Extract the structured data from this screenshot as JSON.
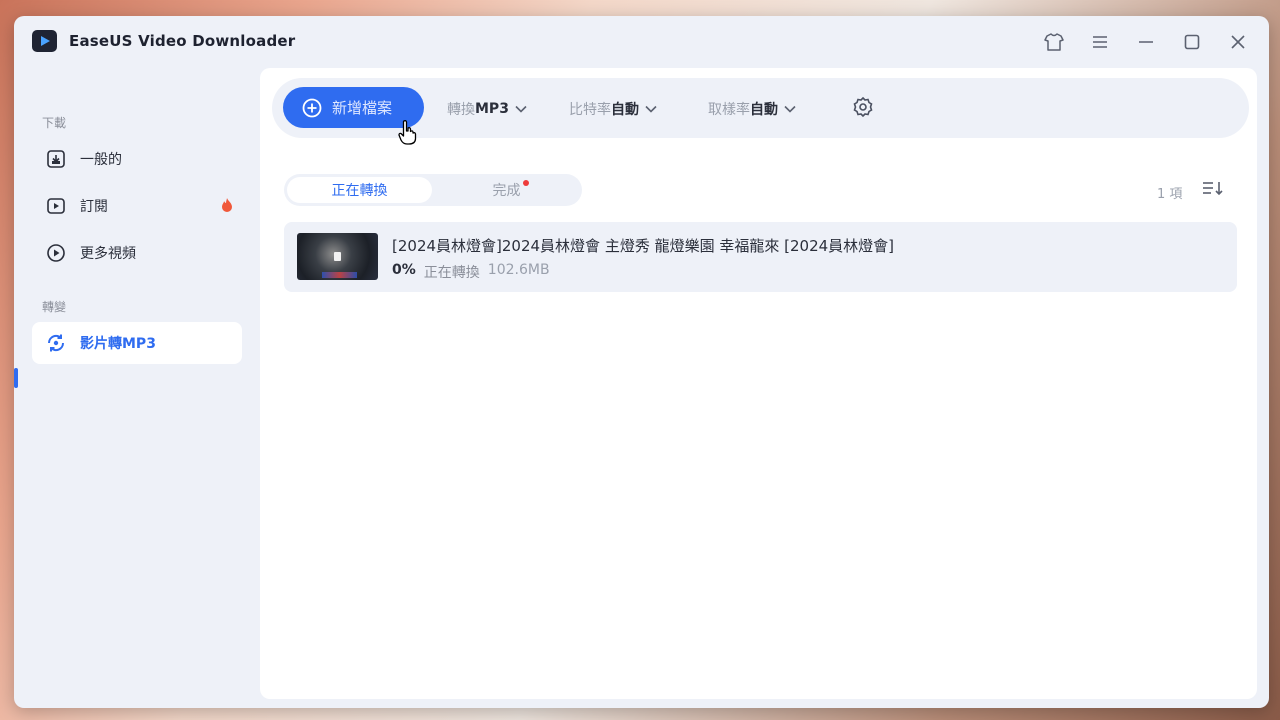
{
  "app": {
    "title": "EaseUS Video Downloader"
  },
  "window_controls": [
    {
      "name": "tshirt-icon"
    },
    {
      "name": "menu-icon"
    },
    {
      "name": "minimize-icon"
    },
    {
      "name": "maximize-icon"
    },
    {
      "name": "close-icon"
    }
  ],
  "sidebar": {
    "section_download": "下載",
    "items": [
      {
        "label": "一般的",
        "icon": "download-icon"
      },
      {
        "label": "訂閱",
        "icon": "subscribe-icon",
        "badge_icon": "fire-icon"
      },
      {
        "label": "更多視頻",
        "icon": "more-videos-icon"
      }
    ],
    "section_convert": "轉變",
    "convert_item": {
      "label": "影片轉MP3",
      "icon": "convert-icon",
      "active": true
    }
  },
  "toolbar": {
    "add_label": "新增檔案",
    "format_prefix": "轉換",
    "format_value": "MP3",
    "bitrate_prefix": "比特率",
    "bitrate_value": "自動",
    "samplerate_prefix": "取樣率",
    "samplerate_value": "自動"
  },
  "tabs": {
    "converting": "正在轉換",
    "done": "完成"
  },
  "list_count": "1 項",
  "items": [
    {
      "title": "[2024員林燈會]2024員林燈會 主燈秀 龍燈樂園 幸福龍來 [2024員林燈會]",
      "progress": "0%",
      "status": "正在轉換",
      "size": "102.6MB"
    }
  ],
  "colors": {
    "accent": "#2f6cf0",
    "badge": "#ee3b3b"
  }
}
